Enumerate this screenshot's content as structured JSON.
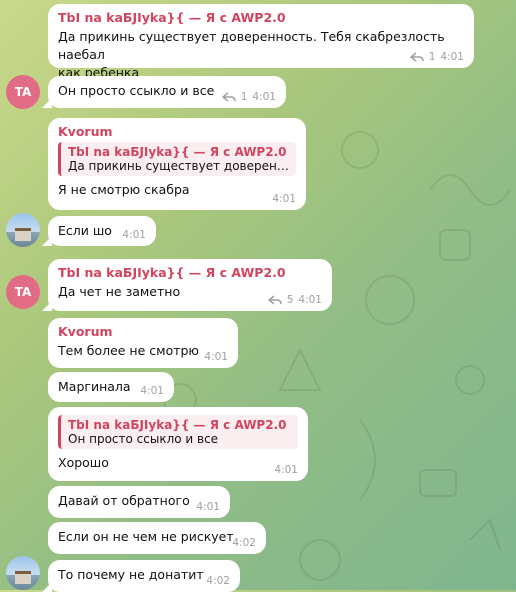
{
  "messages": [
    {
      "sender": "TbI na kaБJIyka}{ — Я с AWP2.0",
      "text_line1": "Да прикинь существует доверенность. Тебя скабрезлость наебал",
      "text_line2": "как ребенка",
      "replies": "1",
      "time": "4:01"
    },
    {
      "avatar": "TA",
      "text": "Он просто ссыкло и все",
      "replies": "1",
      "time": "4:01"
    },
    {
      "sender": "Kvorum",
      "reply_name": "TbI na kaБJIyka}{ — Я с AWP2.0",
      "reply_text": "Да прикинь существует доверенн...",
      "text": "Я не смотрю скабра",
      "time": "4:01"
    },
    {
      "text": "Если шо",
      "time": "4:01"
    },
    {
      "avatar": "TA",
      "sender": "TbI na kaБJIyka}{ — Я с AWP2.0",
      "text": "Да чет не заметно",
      "replies": "5",
      "time": "4:01"
    },
    {
      "sender": "Kvorum",
      "text": "Тем более не смотрю",
      "time": "4:01"
    },
    {
      "text": "Маргинала",
      "time": "4:01"
    },
    {
      "reply_name": "TbI na kaБJIyka}{ — Я с AWP2.0",
      "reply_text": "Он просто ссыкло и все",
      "text": "Хорошо",
      "time": "4:01"
    },
    {
      "text": "Давай от обратного",
      "time": "4:01"
    },
    {
      "text": "Если он не чем не рискует",
      "time": "4:02"
    },
    {
      "text": "То почему не донатит",
      "time": "4:02"
    }
  ]
}
